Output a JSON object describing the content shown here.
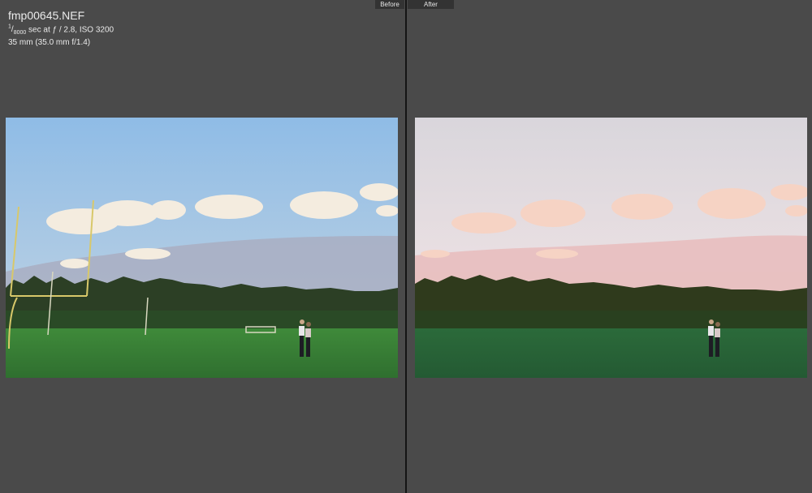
{
  "file_info": {
    "filename": "fmp00645.NEF",
    "shutter_numerator": "1",
    "shutter_denominator": "8000",
    "exposure_rest": " sec at ƒ / 2.8, ISO 3200",
    "lens": "35 mm (35.0 mm f/1.4)"
  },
  "tabs": {
    "before": "Before",
    "after": "After"
  },
  "colors": {
    "before_sky_top": "#8fbce6",
    "before_sky_bottom": "#c7d6e2",
    "before_grass": "#3f8a3a",
    "after_sky_top": "#d9d6dc",
    "after_sky_bottom": "#e8c8c8",
    "after_grass": "#2b6a3a",
    "background": "#4a4a4a",
    "divider": "#141414"
  }
}
